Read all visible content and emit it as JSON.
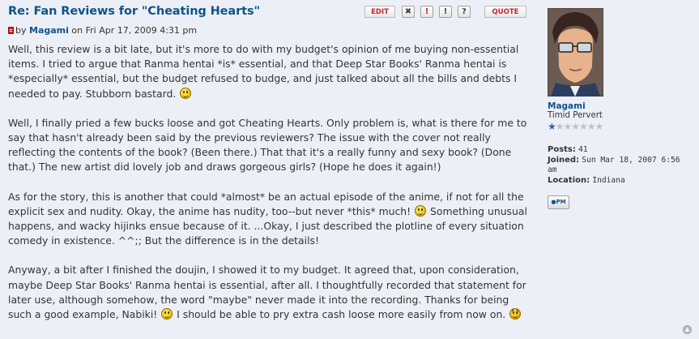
{
  "post": {
    "title": "Re: Fan Reviews for \"Cheating Hearts\"",
    "by": "by",
    "author": "Magami",
    "date": "on Fri Apr 17, 2009 4:31 pm",
    "paragraphs": [
      [
        "Well, this review is a bit late, but it's more to do with my budget's opinion of me buying non-essential items. I tried to argue that Ranma hentai *is* essential, and that Deep Star Books' Ranma hentai is *especially* essential, but the budget refused to budge, and just talked about all the bills and debts I needed to pay. Stubborn bastard.",
        ""
      ],
      [
        "Well, I finally pried a few bucks loose and got Cheating Hearts. Only problem is, what is there for me to say that hasn't already been said by the previous reviewers? The issue with the cover not really reflecting the contents of the book? (Been there.) That that it's a really funny and sexy book? (Done that.) The new artist did lovely job and draws gorgeous girls? (Hope he does it again!)"
      ],
      [
        "As for the story, this is another that could *almost* be an actual episode of the anime, if not for all the explicit sex and nudity. Okay, the anime has nudity, too--but never *this* much!",
        " Something unusual happens, and wacky hijinks ensue because of it. ...Okay, I just described the plotline of every situation comedy in existence. ^^;; But the difference is in the details!"
      ],
      [
        "Anyway, a bit after I finished the doujin, I showed it to my budget. It agreed that, upon consideration, maybe Deep Star Books' Ranma hentai is essential, after all. I thoughtfully recorded that statement for later use, although somehow, the word \"maybe\" never made it into the recording. Thanks for being such a good example, Nabiki!",
        " I should be able to pry extra cash loose more easily from now on.",
        ""
      ]
    ]
  },
  "buttons": {
    "edit": "EDIT",
    "delete": "✖",
    "report": "!",
    "warn": "!",
    "info": "?",
    "quote": "QUOTE"
  },
  "profile": {
    "username": "Magami",
    "rank": "Timid Pervert",
    "stars_filled": 1,
    "stars_total": 7,
    "posts_label": "Posts:",
    "posts_value": "41",
    "joined_label": "Joined:",
    "joined_value": "Sun Mar 18, 2007 6:56 am",
    "location_label": "Location:",
    "location_value": "Indiana",
    "pm_label": "PM"
  },
  "colors": {
    "background": "#ecf0f6",
    "link": "#105289",
    "button_text": "#c6242f"
  },
  "icons": {
    "post": "post-icon",
    "smiley": "smiley-icon",
    "evil": "evil-smiley-icon",
    "back_to_top": "back-to-top-icon"
  }
}
